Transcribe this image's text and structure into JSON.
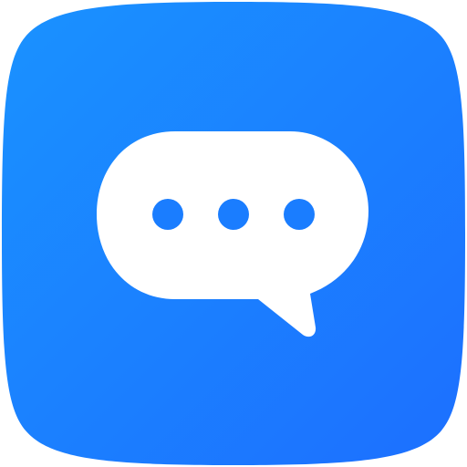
{
  "app_icon": {
    "name": "chat-app",
    "icon": "speech-bubble-typing-icon",
    "colors": {
      "gradient_start": "#1A92FF",
      "gradient_end": "#1C6FFF",
      "bubble": "#FFFFFF",
      "dots": "#1A7DFF"
    },
    "typing_dots": 3
  }
}
